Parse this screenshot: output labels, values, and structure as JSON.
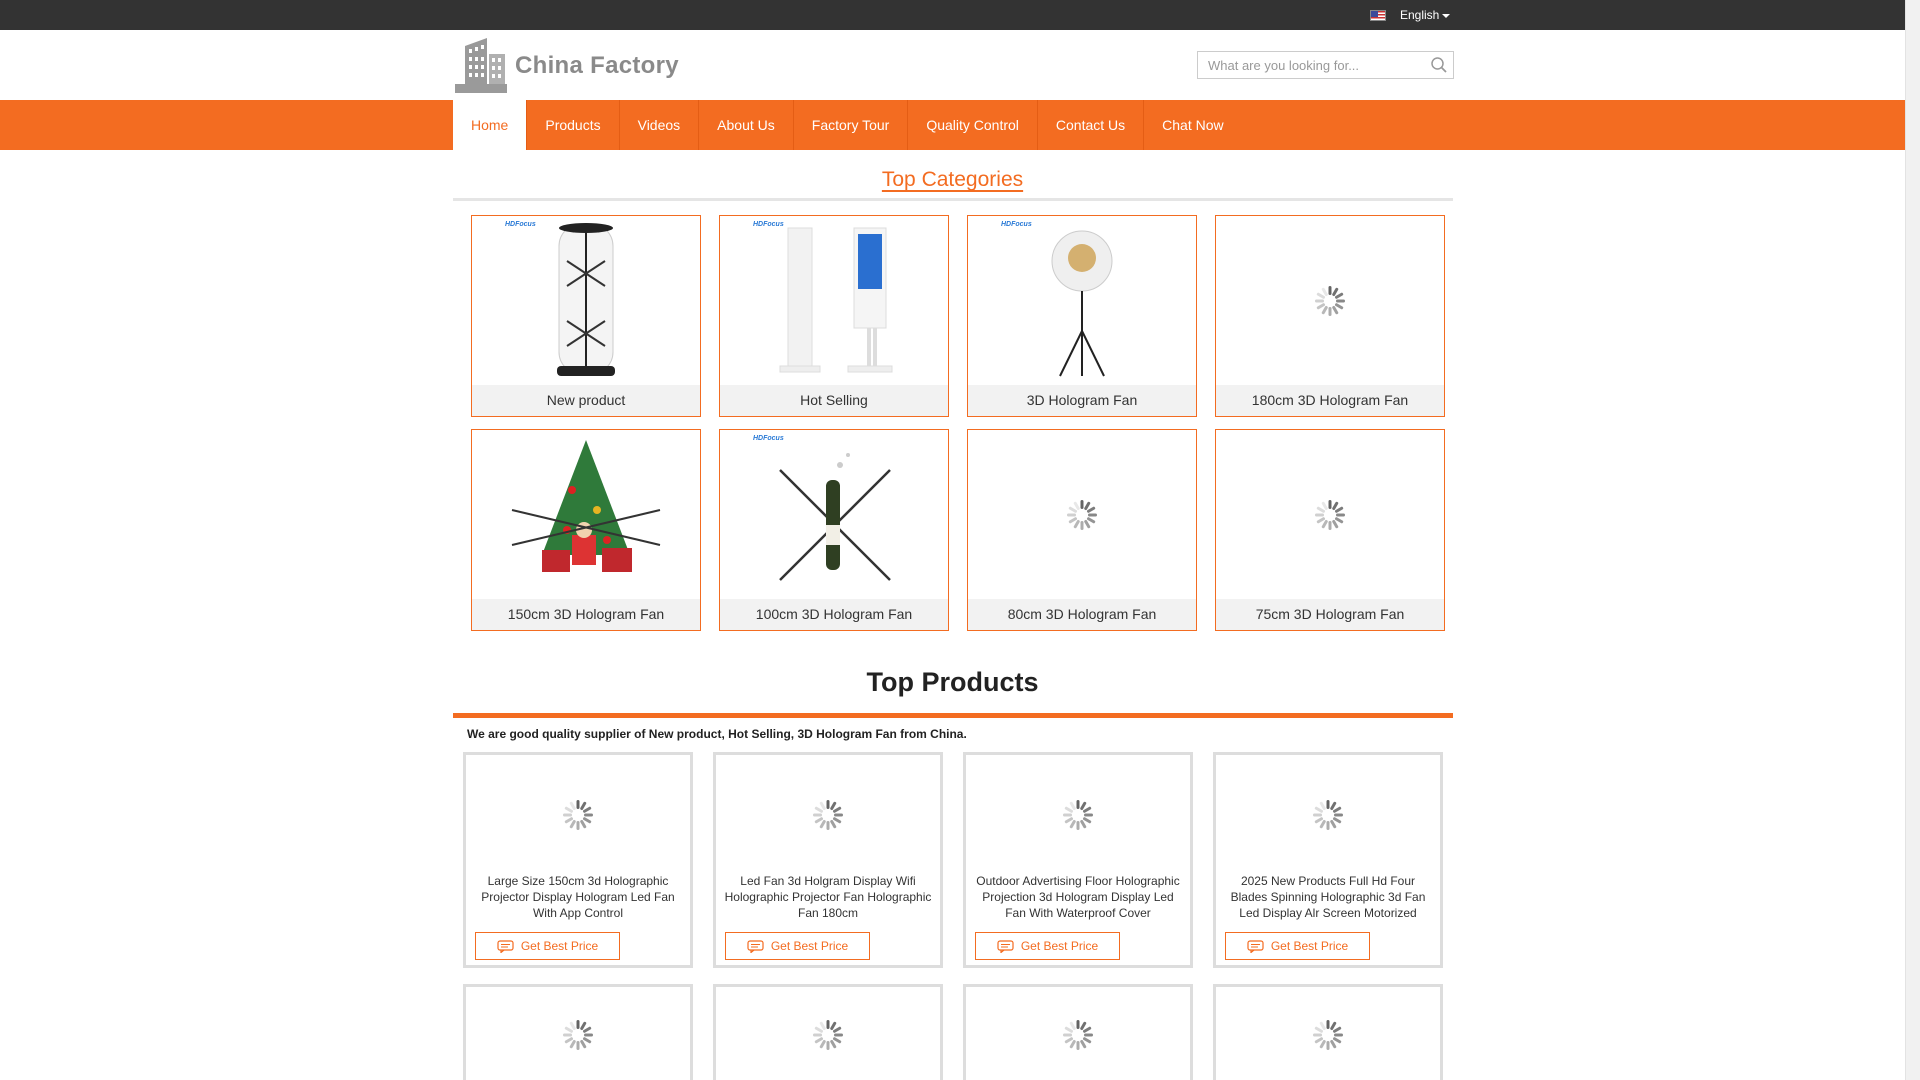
{
  "topbar": {
    "language": "English",
    "flag_icon": "us-flag-icon"
  },
  "header": {
    "logo_text": "China Factory",
    "search_placeholder": "What are you looking for..."
  },
  "nav": {
    "items": [
      "Home",
      "Products",
      "Videos",
      "About Us",
      "Factory Tour",
      "Quality Control",
      "Contact Us",
      "Chat Now"
    ],
    "active": "Home"
  },
  "categories": {
    "title": "Top Categories",
    "items": [
      {
        "label": "New product",
        "image": "cylindrical-hologram-fan",
        "tag": "HDFocus"
      },
      {
        "label": "Hot Selling",
        "image": "kiosk-display",
        "tag": "HDFocus"
      },
      {
        "label": "3D Hologram Fan",
        "image": "hologram-fan-tripod",
        "tag": "HDFocus"
      },
      {
        "label": "180cm 3D Hologram Fan",
        "image": "loading-placeholder",
        "tag": ""
      },
      {
        "label": "150cm 3D Hologram Fan",
        "image": "christmas-tree-hologram",
        "tag": ""
      },
      {
        "label": "100cm 3D Hologram Fan",
        "image": "bottle-hologram-fan",
        "tag": "HDFocus"
      },
      {
        "label": "80cm 3D Hologram Fan",
        "image": "loading-placeholder",
        "tag": ""
      },
      {
        "label": "75cm 3D Hologram Fan",
        "image": "loading-placeholder",
        "tag": ""
      }
    ]
  },
  "products": {
    "title": "Top Products",
    "intro": "We are good quality supplier of New product, Hot Selling, 3D Hologram Fan from China.",
    "button_label": "Get Best Price",
    "items": [
      {
        "name": "Large Size 150cm 3d Holographic Projector Display Hologram Led Fan With App Control"
      },
      {
        "name": "Led Fan 3d Holgram Display Wifi Holographic Projector Fan Holographic Fan 180cm"
      },
      {
        "name": "Outdoor Advertising Floor Holographic Projection 3d Hologram Display Led Fan With Waterproof Cover"
      },
      {
        "name": "2025 New Products Full Hd Four Blades Spinning Holographic 3d Fan Led Display Alr Screen Motorized"
      }
    ]
  },
  "colors": {
    "accent": "#f36c21",
    "topbar": "#333333",
    "border": "#dddddd"
  }
}
